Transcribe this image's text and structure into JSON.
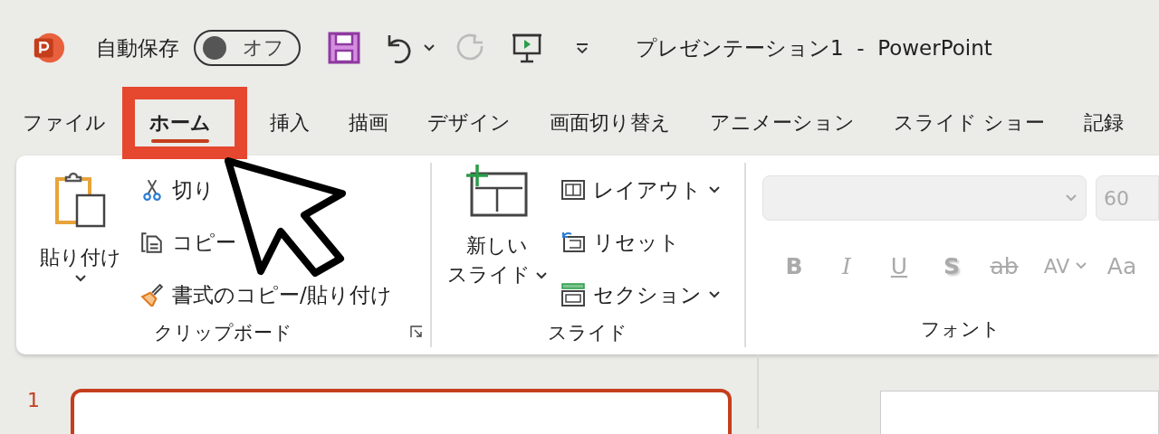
{
  "title_bar": {
    "autosave_label": "自動保存",
    "autosave_toggle": {
      "label": "オフ",
      "on": false
    },
    "document_title": "プレゼンテーション1  -  PowerPoint"
  },
  "tabs": [
    {
      "label": "ファイル",
      "selected": false,
      "highlighted": false
    },
    {
      "label": "ホーム",
      "selected": true,
      "highlighted": true
    },
    {
      "label": "挿入",
      "selected": false,
      "highlighted": false
    },
    {
      "label": "描画",
      "selected": false,
      "highlighted": false
    },
    {
      "label": "デザイン",
      "selected": false,
      "highlighted": false
    },
    {
      "label": "画面切り替え",
      "selected": false,
      "highlighted": false
    },
    {
      "label": "アニメーション",
      "selected": false,
      "highlighted": false
    },
    {
      "label": "スライド ショー",
      "selected": false,
      "highlighted": false
    },
    {
      "label": "記録",
      "selected": false,
      "highlighted": false
    }
  ],
  "clipboard": {
    "label": "クリップボード",
    "paste": {
      "label": "貼り付け",
      "dropdown": true
    },
    "small_buttons": [
      {
        "kind": "cut",
        "label": "切り"
      },
      {
        "kind": "copy",
        "label": "コピー"
      },
      {
        "kind": "painter",
        "label": "書式のコピー/貼り付け"
      }
    ]
  },
  "slides": {
    "label": "スライド",
    "new_slide": {
      "label_lines": [
        "新しい",
        "スライド"
      ],
      "dropdown": true
    },
    "small_buttons": [
      {
        "kind": "layout",
        "label": "レイアウト",
        "dropdown": true
      },
      {
        "kind": "reset",
        "label": "リセット",
        "dropdown": false
      },
      {
        "kind": "section",
        "label": "セクション",
        "dropdown": true
      }
    ]
  },
  "font": {
    "label": "フォント",
    "disabled": true,
    "font_size": "60",
    "format_buttons": [
      {
        "kind": "bold",
        "label": "B"
      },
      {
        "kind": "italic",
        "label": "I"
      },
      {
        "kind": "underline",
        "label": "U"
      },
      {
        "kind": "shadow",
        "label": "S"
      },
      {
        "kind": "strike",
        "label": "ab"
      },
      {
        "kind": "spacing",
        "label": "AV"
      },
      {
        "kind": "case",
        "label": "Aa"
      }
    ]
  },
  "slide_pane": {
    "slides": [
      {
        "number": "1",
        "selected": true
      }
    ]
  }
}
